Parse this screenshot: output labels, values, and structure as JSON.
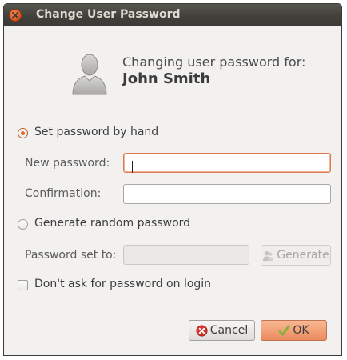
{
  "window": {
    "title": "Change User Password"
  },
  "header": {
    "line": "Changing user password for:",
    "user_name": "John Smith",
    "avatar_icon": "user-avatar-icon"
  },
  "options": {
    "set_by_hand_label": "Set password by hand",
    "set_by_hand_selected": true,
    "new_password_label": "New password:",
    "new_password_value": "",
    "confirmation_label": "Confirmation:",
    "confirmation_value": "",
    "generate_random_label": "Generate random password",
    "generate_random_selected": false,
    "password_set_to_label": "Password set to:",
    "password_set_to_value": "",
    "generate_button_label": "Generate",
    "dont_ask_label": "Don't ask for password on login",
    "dont_ask_checked": false
  },
  "buttons": {
    "cancel_label": "Cancel",
    "ok_label": "OK"
  },
  "colors": {
    "accent": "#e06a30",
    "titlebar": "#403f3a",
    "window_bg": "#f2f1f0"
  }
}
